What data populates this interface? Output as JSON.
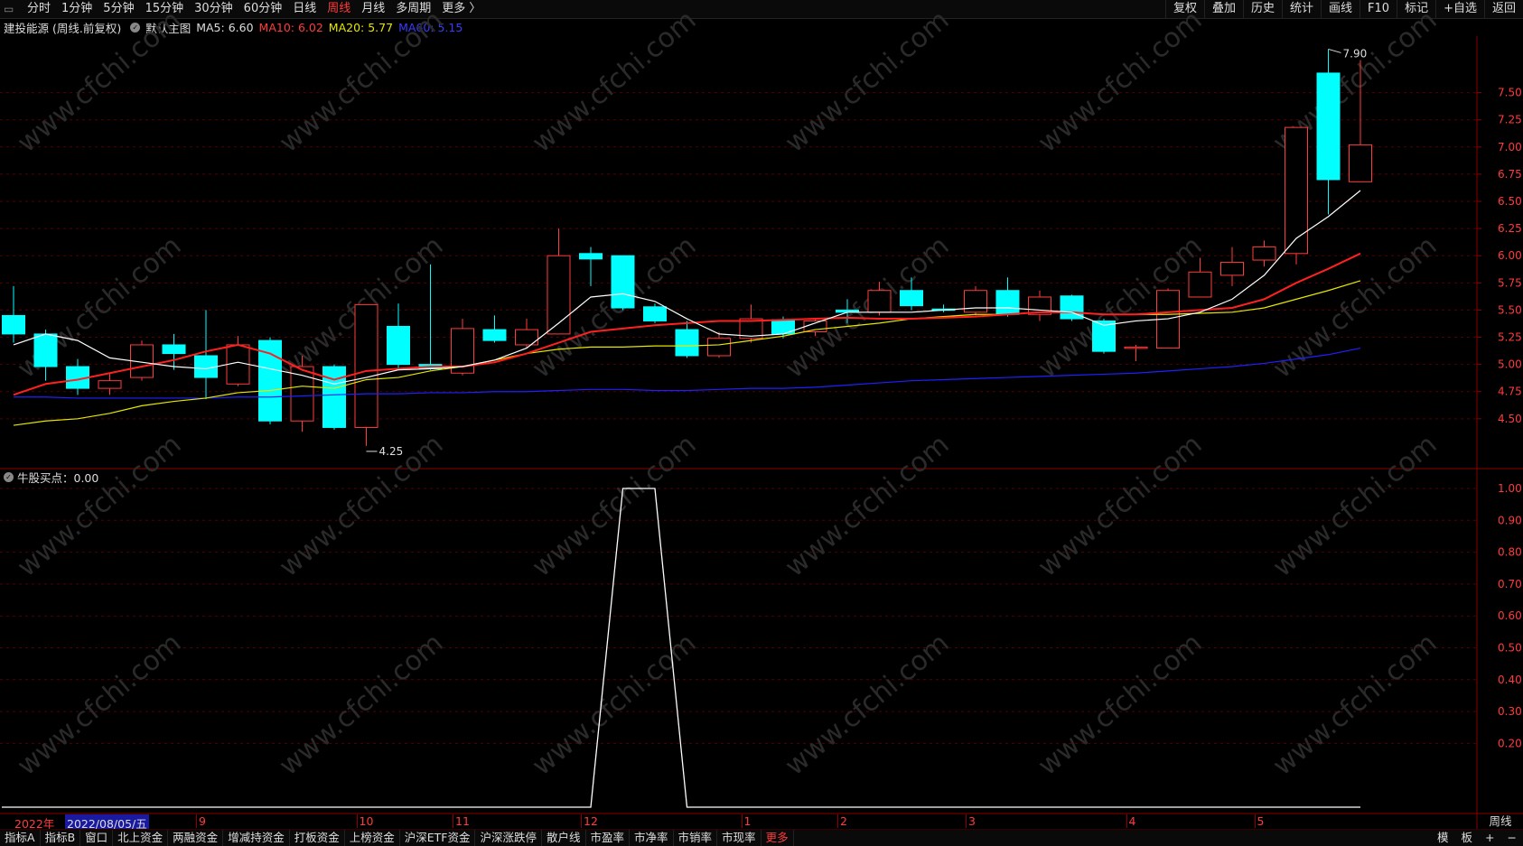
{
  "topbar": {
    "periods": [
      "分时",
      "1分钟",
      "5分钟",
      "15分钟",
      "30分钟",
      "60分钟",
      "日线",
      "周线",
      "月线",
      "多周期",
      "更多 〉"
    ],
    "active_period": "周线",
    "tools": [
      "复权",
      "叠加",
      "历史",
      "统计",
      "画线",
      "F10",
      "标记",
      "+自选",
      "返回"
    ]
  },
  "info": {
    "stock": "建投能源 (周线.前复权)",
    "main_chart": "默认主图",
    "ma5": "MA5: 6.60",
    "ma10": "MA10: 6.02",
    "ma20": "MA20: 5.77",
    "ma60": "MA60: 5.15"
  },
  "colors": {
    "up": "#ff3b3b",
    "down": "#00ffff",
    "ma5": "#ffffff",
    "ma10": "#ff2020",
    "ma20": "#e6e600",
    "ma60": "#2020ff",
    "grid": "#550000"
  },
  "price_axis": [
    "7.50",
    "7.25",
    "7.00",
    "6.75",
    "6.50",
    "6.25",
    "6.00",
    "5.75",
    "5.50",
    "5.25",
    "5.00",
    "4.75",
    "4.50"
  ],
  "annotations": {
    "high": "7.90",
    "low": "4.25"
  },
  "indicator": {
    "label": "牛股买点：0.00",
    "axis": [
      "1.00",
      "0.90",
      "0.80",
      "0.70",
      "0.60",
      "0.50",
      "0.40",
      "0.30",
      "0.20"
    ]
  },
  "xaxis": {
    "year": "2022年",
    "cursor_date": "2022/08/05/五",
    "months": [
      "9",
      "10",
      "11",
      "12",
      "1",
      "2",
      "3",
      "4",
      "5"
    ],
    "period_tag": "周线"
  },
  "bottom_tabs": [
    "指标A",
    "指标B",
    "窗口",
    "北上资金",
    "两融资金",
    "增减持资金",
    "打板资金",
    "上榜资金",
    "沪深ETF资金",
    "沪深涨跌停",
    "散户线",
    "市盈率",
    "市净率",
    "市销率",
    "市现率",
    "更多"
  ],
  "bottom_right": [
    "模",
    "板",
    "+",
    "−"
  ],
  "watermark": "www.cfchi.com",
  "chart_data": {
    "type": "candlestick",
    "candles": [
      {
        "o": 5.45,
        "c": 5.28,
        "h": 5.72,
        "l": 5.2
      },
      {
        "o": 5.28,
        "c": 4.98,
        "h": 5.32,
        "l": 4.85
      },
      {
        "o": 4.98,
        "c": 4.78,
        "h": 5.05,
        "l": 4.72
      },
      {
        "o": 4.78,
        "c": 4.85,
        "h": 4.92,
        "l": 4.72
      },
      {
        "o": 4.88,
        "c": 5.18,
        "h": 5.22,
        "l": 4.85
      },
      {
        "o": 5.18,
        "c": 5.1,
        "h": 5.28,
        "l": 4.95
      },
      {
        "o": 5.08,
        "c": 4.88,
        "h": 5.5,
        "l": 4.68
      },
      {
        "o": 4.82,
        "c": 5.18,
        "h": 5.26,
        "l": 4.8
      },
      {
        "o": 5.22,
        "c": 4.48,
        "h": 5.25,
        "l": 4.45
      },
      {
        "o": 4.48,
        "c": 4.98,
        "h": 5.08,
        "l": 4.38
      },
      {
        "o": 4.98,
        "c": 4.42,
        "h": 5.0,
        "l": 4.4
      },
      {
        "o": 4.42,
        "c": 5.55,
        "h": 5.55,
        "l": 4.25
      },
      {
        "o": 5.35,
        "c": 5.0,
        "h": 5.56,
        "l": 4.95
      },
      {
        "o": 5.0,
        "c": 4.96,
        "h": 5.92,
        "l": 4.95
      },
      {
        "o": 4.92,
        "c": 5.33,
        "h": 5.42,
        "l": 4.9
      },
      {
        "o": 5.32,
        "c": 5.22,
        "h": 5.45,
        "l": 5.2
      },
      {
        "o": 5.18,
        "c": 5.32,
        "h": 5.42,
        "l": 5.15
      },
      {
        "o": 5.28,
        "c": 6.0,
        "h": 6.25,
        "l": 5.28
      },
      {
        "o": 6.02,
        "c": 5.97,
        "h": 6.08,
        "l": 5.72
      },
      {
        "o": 6.0,
        "c": 5.52,
        "h": 6.0,
        "l": 5.5
      },
      {
        "o": 5.53,
        "c": 5.4,
        "h": 5.56,
        "l": 5.38
      },
      {
        "o": 5.32,
        "c": 5.08,
        "h": 5.4,
        "l": 5.06
      },
      {
        "o": 5.08,
        "c": 5.24,
        "h": 5.3,
        "l": 5.06
      },
      {
        "o": 5.24,
        "c": 5.42,
        "h": 5.55,
        "l": 5.2
      },
      {
        "o": 5.41,
        "c": 5.28,
        "h": 5.44,
        "l": 5.24
      },
      {
        "o": 5.3,
        "c": 5.4,
        "h": 5.42,
        "l": 5.26
      },
      {
        "o": 5.5,
        "c": 5.48,
        "h": 5.6,
        "l": 5.38
      },
      {
        "o": 5.48,
        "c": 5.68,
        "h": 5.76,
        "l": 5.45
      },
      {
        "o": 5.68,
        "c": 5.54,
        "h": 5.8,
        "l": 5.5
      },
      {
        "o": 5.51,
        "c": 5.5,
        "h": 5.55,
        "l": 5.48
      },
      {
        "o": 5.48,
        "c": 5.68,
        "h": 5.72,
        "l": 5.45
      },
      {
        "o": 5.68,
        "c": 5.46,
        "h": 5.8,
        "l": 5.44
      },
      {
        "o": 5.46,
        "c": 5.62,
        "h": 5.68,
        "l": 5.4
      },
      {
        "o": 5.63,
        "c": 5.42,
        "h": 5.64,
        "l": 5.4
      },
      {
        "o": 5.4,
        "c": 5.12,
        "h": 5.42,
        "l": 5.1
      },
      {
        "o": 5.15,
        "c": 5.16,
        "h": 5.18,
        "l": 5.03
      },
      {
        "o": 5.15,
        "c": 5.68,
        "h": 5.7,
        "l": 5.15
      },
      {
        "o": 5.62,
        "c": 5.85,
        "h": 5.98,
        "l": 5.62
      },
      {
        "o": 5.82,
        "c": 5.94,
        "h": 6.08,
        "l": 5.72
      },
      {
        "o": 5.96,
        "c": 6.08,
        "h": 6.14,
        "l": 5.9
      },
      {
        "o": 6.02,
        "c": 7.18,
        "h": 7.18,
        "l": 5.92
      },
      {
        "o": 7.68,
        "c": 6.7,
        "h": 7.9,
        "l": 6.38
      },
      {
        "o": 6.68,
        "c": 7.02,
        "h": 7.8,
        "l": 6.68
      }
    ],
    "ma5": [
      5.18,
      5.28,
      5.22,
      5.06,
      5.02,
      4.98,
      4.96,
      5.02,
      4.96,
      4.9,
      4.82,
      4.88,
      4.95,
      4.96,
      4.98,
      5.04,
      5.15,
      5.38,
      5.62,
      5.65,
      5.58,
      5.42,
      5.28,
      5.26,
      5.28,
      5.38,
      5.48,
      5.48,
      5.48,
      5.5,
      5.52,
      5.52,
      5.5,
      5.48,
      5.36,
      5.4,
      5.42,
      5.48,
      5.6,
      5.82,
      6.16,
      6.36,
      6.6
    ],
    "ma10": [
      4.72,
      4.82,
      4.86,
      4.92,
      4.98,
      5.04,
      5.12,
      5.18,
      5.1,
      4.95,
      4.86,
      4.94,
      4.96,
      4.98,
      4.98,
      5.02,
      5.1,
      5.2,
      5.3,
      5.33,
      5.36,
      5.38,
      5.4,
      5.4,
      5.41,
      5.42,
      5.43,
      5.42,
      5.42,
      5.43,
      5.44,
      5.46,
      5.48,
      5.48,
      5.46,
      5.46,
      5.48,
      5.5,
      5.52,
      5.6,
      5.75,
      5.88,
      6.02
    ],
    "ma20": [
      4.44,
      4.48,
      4.5,
      4.55,
      4.62,
      4.66,
      4.69,
      4.74,
      4.76,
      4.8,
      4.78,
      4.86,
      4.88,
      4.94,
      4.98,
      5.04,
      5.1,
      5.14,
      5.16,
      5.16,
      5.17,
      5.17,
      5.18,
      5.22,
      5.26,
      5.32,
      5.35,
      5.38,
      5.42,
      5.44,
      5.46,
      5.46,
      5.48,
      5.48,
      5.46,
      5.46,
      5.46,
      5.47,
      5.48,
      5.52,
      5.6,
      5.68,
      5.77
    ],
    "ma60": [
      4.7,
      4.7,
      4.69,
      4.69,
      4.69,
      4.69,
      4.69,
      4.7,
      4.7,
      4.71,
      4.72,
      4.73,
      4.73,
      4.74,
      4.74,
      4.75,
      4.75,
      4.76,
      4.77,
      4.77,
      4.76,
      4.76,
      4.77,
      4.78,
      4.78,
      4.79,
      4.81,
      4.83,
      4.85,
      4.86,
      4.87,
      4.88,
      4.89,
      4.9,
      4.91,
      4.92,
      4.94,
      4.96,
      4.98,
      5.01,
      5.05,
      5.09,
      5.15
    ],
    "buy_signal": [
      0,
      0,
      0,
      0,
      0,
      0,
      0,
      0,
      0,
      0,
      0,
      0,
      0,
      0,
      0,
      0,
      0,
      0,
      0,
      1,
      1,
      0,
      0,
      0,
      0,
      0,
      0,
      0,
      0,
      0,
      0,
      0,
      0,
      0,
      0,
      0,
      0,
      0,
      0,
      0,
      0,
      0,
      0
    ]
  }
}
